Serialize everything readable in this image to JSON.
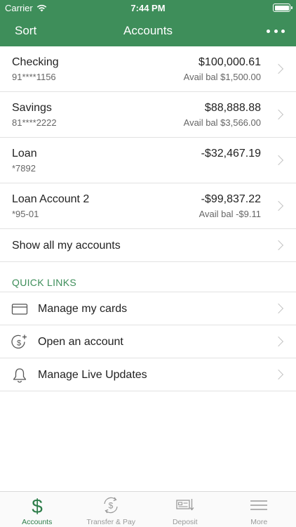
{
  "status_bar": {
    "carrier": "Carrier",
    "time": "7:44 PM"
  },
  "nav": {
    "left_label": "Sort",
    "title": "Accounts",
    "more_icon": "more-icon"
  },
  "accounts": [
    {
      "name": "Checking",
      "number": "91****1156",
      "balance": "$100,000.61",
      "available": "Avail bal $1,500.00"
    },
    {
      "name": "Savings",
      "number": "81****2222",
      "balance": "$88,888.88",
      "available": "Avail bal $3,566.00"
    },
    {
      "name": "Loan",
      "number": "*7892",
      "balance": "-$32,467.19",
      "available": ""
    },
    {
      "name": "Loan Account 2",
      "number": "*95-01",
      "balance": "-$99,837.22",
      "available": "Avail bal -$9.11"
    }
  ],
  "show_all_label": "Show all my accounts",
  "quick_links": {
    "heading": "QUICK LINKS",
    "items": [
      {
        "label": "Manage my cards",
        "icon": "credit-card-icon"
      },
      {
        "label": "Open an account",
        "icon": "dollar-plus-icon"
      },
      {
        "label": "Manage Live Updates",
        "icon": "bell-icon"
      }
    ]
  },
  "tabs": [
    {
      "label": "Accounts",
      "icon": "dollar-icon",
      "active": true
    },
    {
      "label": "Transfer & Pay",
      "icon": "transfer-icon",
      "active": false
    },
    {
      "label": "Deposit",
      "icon": "deposit-check-icon",
      "active": false
    },
    {
      "label": "More",
      "icon": "menu-icon",
      "active": false
    }
  ],
  "colors": {
    "brand_green": "#3e8e5a",
    "active_tab": "#2e7d4a",
    "inactive_tab": "#999999",
    "divider": "#e2e2e2"
  }
}
